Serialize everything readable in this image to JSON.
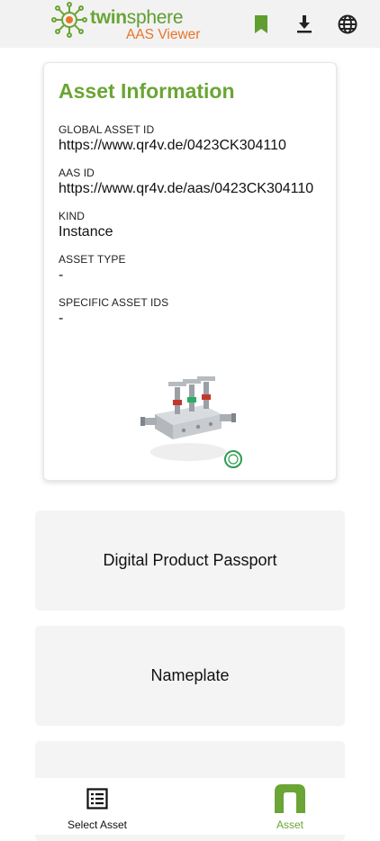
{
  "header": {
    "brand_twin": "twin",
    "brand_sphere": "sphere",
    "brand_sub": "AAS Viewer",
    "icons": [
      "bookmark-icon",
      "download-icon",
      "globe-icon"
    ]
  },
  "asset_info": {
    "title": "Asset Information",
    "fields": [
      {
        "label": "GLOBAL ASSET ID",
        "value": "https://www.qr4v.de/0423CK304110"
      },
      {
        "label": "AAS ID",
        "value": "https://www.qr4v.de/aas/0423CK304110"
      },
      {
        "label": "KIND",
        "value": "Instance"
      },
      {
        "label": "ASSET TYPE",
        "value": "-"
      },
      {
        "label": "SPECIFIC ASSET IDS",
        "value": "-"
      }
    ]
  },
  "submodels": [
    {
      "label": "Digital Product Passport"
    },
    {
      "label": "Nameplate"
    },
    {
      "label": ""
    }
  ],
  "bottom_nav": {
    "items": [
      {
        "label": "Select Asset",
        "icon": "list-icon",
        "active": false
      },
      {
        "label": "Asset",
        "icon": "asset-icon",
        "active": true
      }
    ]
  },
  "colors": {
    "brand_green": "#6aa535",
    "brand_orange": "#e8752a",
    "active_nav": "#6aa535"
  }
}
